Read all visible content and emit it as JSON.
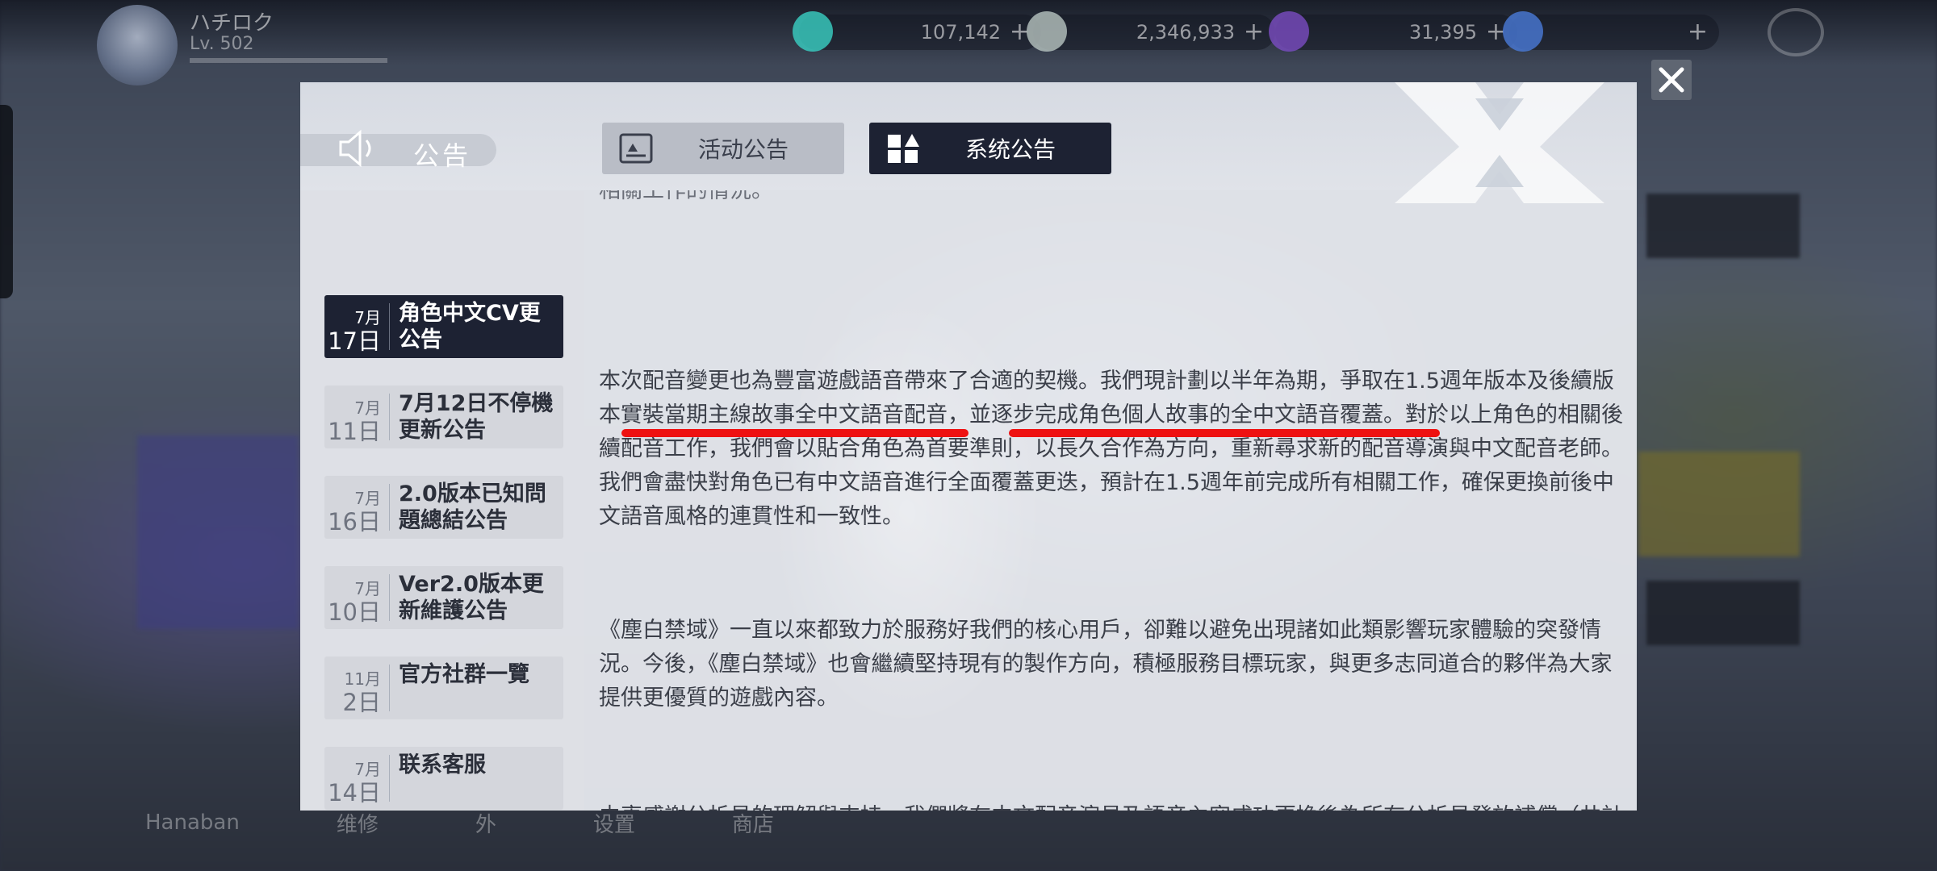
{
  "hud": {
    "player_name": "ハチロク",
    "player_level": "Lv. 502",
    "currencies": [
      {
        "icon": "crystal-icon",
        "amount": "107,142",
        "color": "#3ad1c4"
      },
      {
        "icon": "coin-icon",
        "amount": "2,346,933",
        "color": "#b8c4c0"
      },
      {
        "icon": "gem-icon",
        "amount": "31,395",
        "color": "#7a4cc2"
      },
      {
        "icon": "star-icon",
        "amount": "",
        "color": "#4a7ad8"
      }
    ],
    "bottom_labels": [
      "Hanaban",
      "维修",
      "外",
      "设置",
      "商店"
    ]
  },
  "dialog": {
    "title": "公告",
    "tabs": [
      {
        "label": "活动公告",
        "active": false
      },
      {
        "label": "系统公告",
        "active": true
      }
    ],
    "sidebar": [
      {
        "month": "7月",
        "day": "17日",
        "title": "角色中文CV更公告",
        "active": true
      },
      {
        "month": "7月",
        "day": "11日",
        "title": "7月12日不停機更新公告",
        "active": false
      },
      {
        "month": "7月",
        "day": "16日",
        "title": "2.0版本已知問題總結公告",
        "active": false
      },
      {
        "month": "7月",
        "day": "10日",
        "title": "Ver2.0版本更新維護公告",
        "active": false
      },
      {
        "month": "11月",
        "day": "2日",
        "title": "官方社群一覽",
        "active": false
      },
      {
        "month": "7月",
        "day": "14日",
        "title": "联系客服",
        "active": false
      }
    ],
    "content": {
      "top_fragment": "相關工作的情況。",
      "paragraph1": "本次配音變更也為豐富遊戲語音帶來了合適的契機。我們現計劃以半年為期，爭取在1.5週年版本及後續版本實裝當期主線故事全中文語音配音，並逐步完成角色個人故事的全中文語音覆蓋。對於以上角色的相關後續配音工作，我們會以貼合角色為首要準則，以長久合作為方向，重新尋求新的配音導演與中文配音老師。我們會盡快對角色已有中文語音進行全面覆蓋更迭，預計在1.5週年前完成所有相關工作，確保更換前後中文語音風格的連貫性和一致性。",
      "paragraph2": "《塵白禁域》一直以來都致力於服務好我們的核心用戶，卻難以避免出現諸如此類影響玩家體驗的突發情況。今後，《塵白禁域》也會繼續堅持現有的製作方向，積極服務目標玩家，與更多志同道合的夥伴為大家提供更優質的遊戲內容。",
      "paragraph3": "由衷感謝分析員的理解與支持，我們將在中文配音演員及語音內容成功更換後為所有分析員發放補償（共計數據金*1300），並在本公告發布後次日發放數據金*300補償，共計補償數據金*1600。具體更換時間請關注後續公告。為此在後續版本更新中將計劃取消圖鑑隊員檔案的CV顯示功能。"
    },
    "highlight_color": "#ee1111"
  }
}
